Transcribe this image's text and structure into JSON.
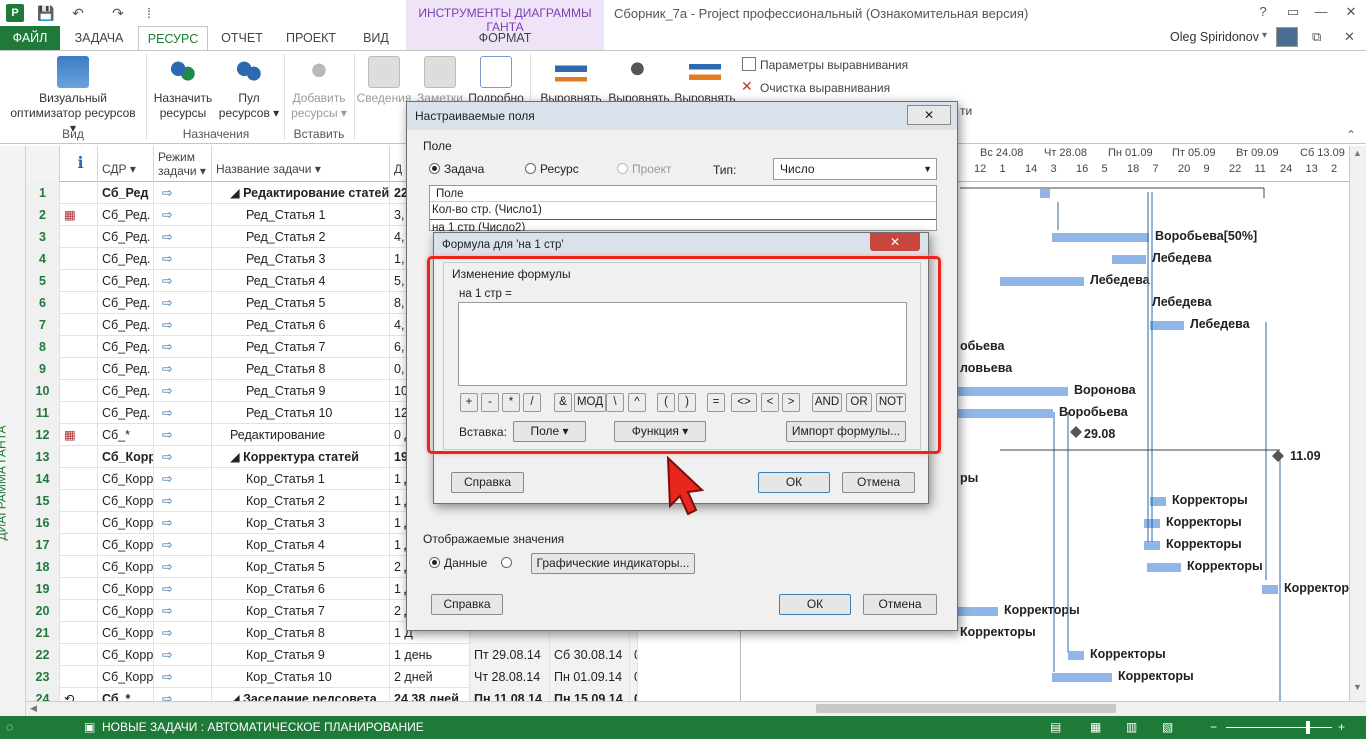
{
  "window": {
    "context_tab_group": "ИНСТРУМЕНТЫ ДИАГРАММЫ ГАНТА",
    "title": "Сборник_7а - Project профессиональный (Ознакомительная версия)",
    "user": "Oleg Spiridonov"
  },
  "tabs": [
    "ФАЙЛ",
    "ЗАДАЧА",
    "РЕСУРС",
    "ОТЧЕТ",
    "ПРОЕКТ",
    "ВИД",
    "ФОРМАТ"
  ],
  "ribbon": {
    "visual_optimizer": {
      "line1": "Визуальный",
      "line2": "оптимизатор ресурсов ▾"
    },
    "group_view": "Вид",
    "assign": {
      "line1": "Назначить",
      "line2": "ресурсы"
    },
    "pool": {
      "line1": "Пул",
      "line2": "ресурсов ▾"
    },
    "group_assign": "Назначения",
    "add": {
      "line1": "Добавить",
      "line2": "ресурсы ▾"
    },
    "group_insert": "Вставить",
    "info": "Сведения",
    "notes": "Заметки",
    "details": "Подробно",
    "level1": "Выровнять",
    "level2": "Выровнять",
    "level3": "Выровнять",
    "leveling_options": "Параметры выравнивания",
    "clear_leveling": "Очистка выравнивания",
    "partial": "ти"
  },
  "grid": {
    "side_label": "ДИАГРАММА ГАНТА",
    "headers": {
      "info": "ℹ",
      "wbs": "СДР ▾",
      "mode_l1": "Режим",
      "mode_l2": "задачи ▾",
      "name": "Название задачи ▾",
      "dur": "Д"
    },
    "rows": [
      {
        "id": "1",
        "wbs": "Сб_Ред",
        "name": "◢ Редактирование статей",
        "dur": "22",
        "start": "",
        "finish": "",
        "extra": "",
        "bold": true,
        "ind": 0
      },
      {
        "id": "2",
        "wbs": "Сб_Ред.",
        "name": "Ред_Статья 1",
        "dur": "3,",
        "start": "",
        "finish": "",
        "extra": "",
        "bold": false,
        "ind": 1
      },
      {
        "id": "3",
        "wbs": "Сб_Ред.",
        "name": "Ред_Статья 2",
        "dur": "4,",
        "start": "",
        "finish": "",
        "extra": "",
        "bold": false,
        "ind": 1
      },
      {
        "id": "4",
        "wbs": "Сб_Ред.",
        "name": "Ред_Статья 3",
        "dur": "1,",
        "start": "",
        "finish": "",
        "extra": "",
        "bold": false,
        "ind": 1
      },
      {
        "id": "5",
        "wbs": "Сб_Ред.",
        "name": "Ред_Статья 4",
        "dur": "5,",
        "start": "",
        "finish": "",
        "extra": "",
        "bold": false,
        "ind": 1
      },
      {
        "id": "6",
        "wbs": "Сб_Ред.",
        "name": "Ред_Статья 5",
        "dur": "8,",
        "start": "",
        "finish": "",
        "extra": "",
        "bold": false,
        "ind": 1
      },
      {
        "id": "7",
        "wbs": "Сб_Ред.",
        "name": "Ред_Статья 6",
        "dur": "4,",
        "start": "",
        "finish": "",
        "extra": "",
        "bold": false,
        "ind": 1
      },
      {
        "id": "8",
        "wbs": "Сб_Ред.",
        "name": "Ред_Статья 7",
        "dur": "6,",
        "start": "",
        "finish": "",
        "extra": "",
        "bold": false,
        "ind": 1
      },
      {
        "id": "9",
        "wbs": "Сб_Ред.",
        "name": "Ред_Статья 8",
        "dur": "0,",
        "start": "",
        "finish": "",
        "extra": "",
        "bold": false,
        "ind": 1
      },
      {
        "id": "10",
        "wbs": "Сб_Ред.",
        "name": "Ред_Статья 9",
        "dur": "10",
        "start": "",
        "finish": "",
        "extra": "",
        "bold": false,
        "ind": 1
      },
      {
        "id": "11",
        "wbs": "Сб_Ред.",
        "name": "Ред_Статья 10",
        "dur": "12",
        "start": "",
        "finish": "",
        "extra": "",
        "bold": false,
        "ind": 1
      },
      {
        "id": "12",
        "wbs": "Сб_*",
        "name": "Редактирование",
        "dur": "0 Д",
        "start": "",
        "finish": "",
        "extra": "",
        "bold": false,
        "ind": 0
      },
      {
        "id": "13",
        "wbs": "Сб_Корр",
        "name": "◢ Корректура статей",
        "dur": "19",
        "start": "",
        "finish": "",
        "extra": "",
        "bold": true,
        "ind": 0
      },
      {
        "id": "14",
        "wbs": "Сб_Корр",
        "name": "Кор_Статья 1",
        "dur": "1 Д",
        "start": "",
        "finish": "",
        "extra": "",
        "bold": false,
        "ind": 1
      },
      {
        "id": "15",
        "wbs": "Сб_Корр",
        "name": "Кор_Статья 2",
        "dur": "1 Д",
        "start": "",
        "finish": "",
        "extra": "",
        "bold": false,
        "ind": 1
      },
      {
        "id": "16",
        "wbs": "Сб_Корр",
        "name": "Кор_Статья 3",
        "dur": "1 Д",
        "start": "",
        "finish": "",
        "extra": "",
        "bold": false,
        "ind": 1
      },
      {
        "id": "17",
        "wbs": "Сб_Корр",
        "name": "Кор_Статья 4",
        "dur": "1 Д",
        "start": "",
        "finish": "",
        "extra": "",
        "bold": false,
        "ind": 1
      },
      {
        "id": "18",
        "wbs": "Сб_Корр",
        "name": "Кор_Статья 5",
        "dur": "2 Д",
        "start": "",
        "finish": "",
        "extra": "",
        "bold": false,
        "ind": 1
      },
      {
        "id": "19",
        "wbs": "Сб_Корр",
        "name": "Кор_Статья 6",
        "dur": "1 Д",
        "start": "",
        "finish": "",
        "extra": "",
        "bold": false,
        "ind": 1
      },
      {
        "id": "20",
        "wbs": "Сб_Корр",
        "name": "Кор_Статья 7",
        "dur": "2 Д",
        "start": "",
        "finish": "",
        "extra": "",
        "bold": false,
        "ind": 1
      },
      {
        "id": "21",
        "wbs": "Сб_Корр",
        "name": "Кор_Статья 8",
        "dur": "1 Д",
        "start": "",
        "finish": "",
        "extra": "",
        "bold": false,
        "ind": 1
      },
      {
        "id": "22",
        "wbs": "Сб_Корр",
        "name": "Кор_Статья 9",
        "dur": "1 день",
        "start": "Пт 29.08.14",
        "finish": "Сб 30.08.14",
        "extra": "0",
        "bold": false,
        "ind": 1
      },
      {
        "id": "23",
        "wbs": "Сб_Корр",
        "name": "Кор_Статья 10",
        "dur": "2 дней",
        "start": "Чт 28.08.14",
        "finish": "Пн 01.09.14",
        "extra": "0",
        "bold": false,
        "ind": 1
      },
      {
        "id": "24",
        "wbs": "Сб_*",
        "name": "◢ Заседание редсовета",
        "dur": "24,38 дней",
        "start": "Пн 11.08.14",
        "finish": "Пн 15.09.14",
        "extra": "0",
        "bold": true,
        "ind": 0
      }
    ]
  },
  "gantt": {
    "dates": [
      "Вс 24.08",
      "Чт 28.08",
      "Пн 01.09",
      "Пт 05.09",
      "Вт 09.09",
      "Сб 13.09"
    ],
    "day_nums": [
      "12",
      "1",
      "14",
      "3",
      "16",
      "5",
      "18",
      "7",
      "20",
      "9",
      "22",
      "11",
      "24",
      "13",
      "2"
    ],
    "bars": [
      {
        "row": 1,
        "start": 300,
        "span": 10,
        "label": ""
      },
      {
        "row": 3,
        "start": 312,
        "span": 97,
        "label": "Воробьева[50%]"
      },
      {
        "row": 4,
        "start": 372,
        "span": 34,
        "label": "Лебедева"
      },
      {
        "row": 5,
        "start": 260,
        "span": 84,
        "label": "Лебедева"
      },
      {
        "row": 6,
        "start": 0,
        "span": 0,
        "label": "Лебедева"
      },
      {
        "row": 7,
        "start": 410,
        "span": 34,
        "label": "Лебедева"
      },
      {
        "row": 8,
        "start": 0,
        "span": 0,
        "label": "обьева"
      },
      {
        "row": 9,
        "start": 0,
        "span": 0,
        "label": "ловьева"
      },
      {
        "row": 10,
        "start": 218,
        "span": 110,
        "label": "Воронова"
      },
      {
        "row": 11,
        "start": 218,
        "span": 95,
        "label": "Воробьева"
      },
      {
        "row": 12,
        "start": 0,
        "span": 0,
        "label": "29.08"
      },
      {
        "row": 13,
        "start": 0,
        "span": 0,
        "label": "11.09"
      },
      {
        "row": 14,
        "start": 0,
        "span": 0,
        "label": "ры"
      },
      {
        "row": 15,
        "start": 410,
        "span": 16,
        "label": "Корректоры"
      },
      {
        "row": 16,
        "start": 404,
        "span": 16,
        "label": "Корректоры"
      },
      {
        "row": 17,
        "start": 404,
        "span": 16,
        "label": "Корректоры"
      },
      {
        "row": 18,
        "start": 407,
        "span": 34,
        "label": "Корректоры"
      },
      {
        "row": 19,
        "start": 522,
        "span": 16,
        "label": "Корректор"
      },
      {
        "row": 20,
        "start": 218,
        "span": 40,
        "label": "Корректоры"
      },
      {
        "row": 21,
        "start": 0,
        "span": 0,
        "label": "Корректоры"
      },
      {
        "row": 22,
        "start": 328,
        "span": 16,
        "label": "Корректоры"
      },
      {
        "row": 23,
        "start": 312,
        "span": 60,
        "label": "Корректоры"
      }
    ]
  },
  "status": "НОВЫЕ ЗАДАЧИ : АВТОМАТИЧЕСКОЕ ПЛАНИРОВАНИЕ",
  "custom_fields": {
    "title": "Настраиваемые поля",
    "field_section": "Поле",
    "radio_task": "Задача",
    "radio_resource": "Ресурс",
    "radio_project": "Проект",
    "type_label": "Тип:",
    "type_value": "Число",
    "list_header": "Поле",
    "list_items": [
      "Кол-во стр. (Число1)",
      "на 1 стр (Число2)"
    ],
    "displayed_values": "Отображаемые значения",
    "radio_data": "Данные",
    "graphic_indicators": "Графические индикаторы...",
    "help": "Справка",
    "ok": "ОК",
    "cancel": "Отмена"
  },
  "formula": {
    "title": "Формула для 'на 1 стр'",
    "section": "Изменение формулы",
    "field_label": "на 1 стр =",
    "value": "",
    "ops": [
      "+",
      "-",
      "*",
      "/",
      "&",
      "МОД",
      "\\",
      "^",
      "(",
      ")",
      "=",
      "<>",
      "<",
      ">",
      "AND",
      "OR",
      "NOT"
    ],
    "insert_label": "Вставка:",
    "field_btn": "Поле ▾",
    "function_btn": "Функция ▾",
    "import_btn": "Импорт формулы...",
    "help": "Справка",
    "ok": "ОК",
    "cancel": "Отмена"
  },
  "colors": {
    "brand": "#1f7a3a",
    "highlight": "#e8261d",
    "bar": "#8fb6e6"
  }
}
